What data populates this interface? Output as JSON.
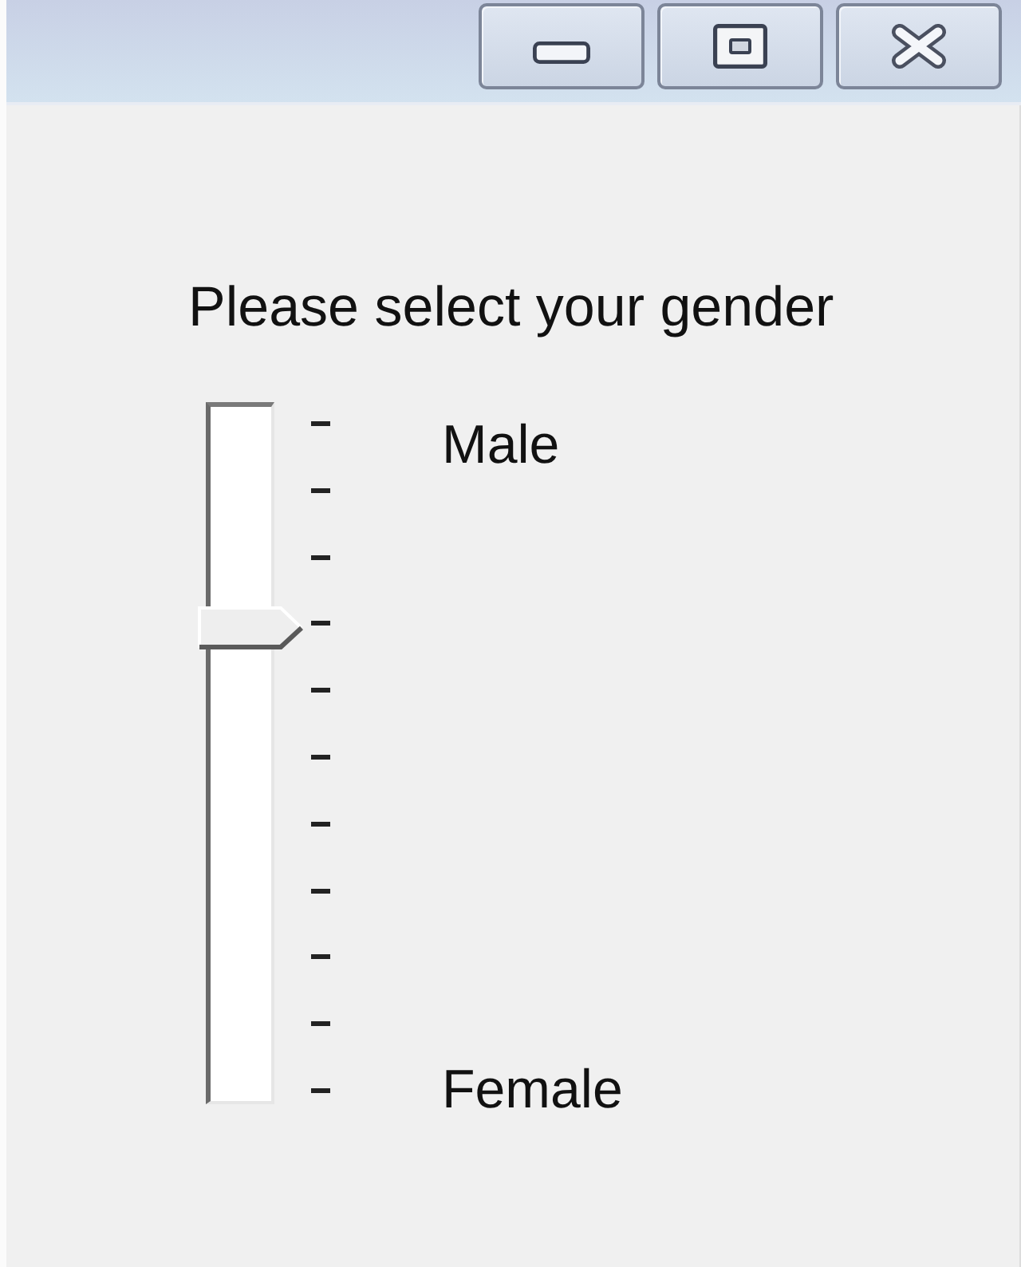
{
  "window_controls": [
    {
      "kind": "minimize"
    },
    {
      "kind": "maximize"
    },
    {
      "kind": "close"
    }
  ],
  "prompt": "Please select your gender",
  "gender_slider": {
    "level": 0.7,
    "top_label": "Male",
    "bottom_label": "Female"
  }
}
